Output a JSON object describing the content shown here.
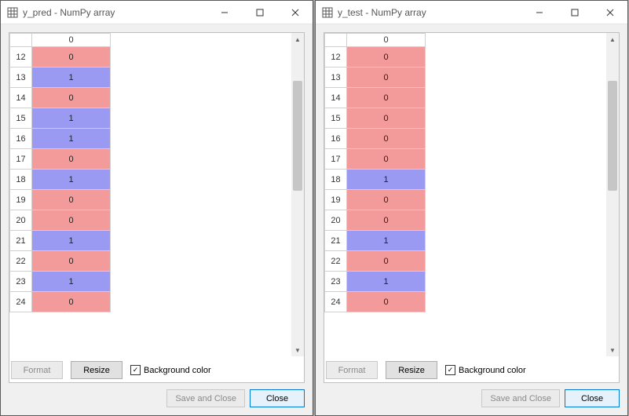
{
  "colors": {
    "val0": "#f39a9a",
    "val1": "#9a9af3",
    "accent": "#0078d7"
  },
  "column_header": "0",
  "windows": [
    {
      "title": "y_pred - NumPy array",
      "rows": [
        {
          "idx": "12",
          "val": "0"
        },
        {
          "idx": "13",
          "val": "1"
        },
        {
          "idx": "14",
          "val": "0"
        },
        {
          "idx": "15",
          "val": "1"
        },
        {
          "idx": "16",
          "val": "1"
        },
        {
          "idx": "17",
          "val": "0"
        },
        {
          "idx": "18",
          "val": "1"
        },
        {
          "idx": "19",
          "val": "0"
        },
        {
          "idx": "20",
          "val": "0"
        },
        {
          "idx": "21",
          "val": "1"
        },
        {
          "idx": "22",
          "val": "0"
        },
        {
          "idx": "23",
          "val": "1"
        },
        {
          "idx": "24",
          "val": "0"
        }
      ]
    },
    {
      "title": "y_test - NumPy array",
      "rows": [
        {
          "idx": "12",
          "val": "0"
        },
        {
          "idx": "13",
          "val": "0"
        },
        {
          "idx": "14",
          "val": "0"
        },
        {
          "idx": "15",
          "val": "0"
        },
        {
          "idx": "16",
          "val": "0"
        },
        {
          "idx": "17",
          "val": "0"
        },
        {
          "idx": "18",
          "val": "1"
        },
        {
          "idx": "19",
          "val": "0"
        },
        {
          "idx": "20",
          "val": "0"
        },
        {
          "idx": "21",
          "val": "1"
        },
        {
          "idx": "22",
          "val": "0"
        },
        {
          "idx": "23",
          "val": "1"
        },
        {
          "idx": "24",
          "val": "0"
        }
      ]
    }
  ],
  "buttons": {
    "format": "Format",
    "resize": "Resize",
    "bg_checkbox_label": "Background color",
    "bg_checkbox_checked": true,
    "save_and_close": "Save and Close",
    "close": "Close"
  }
}
